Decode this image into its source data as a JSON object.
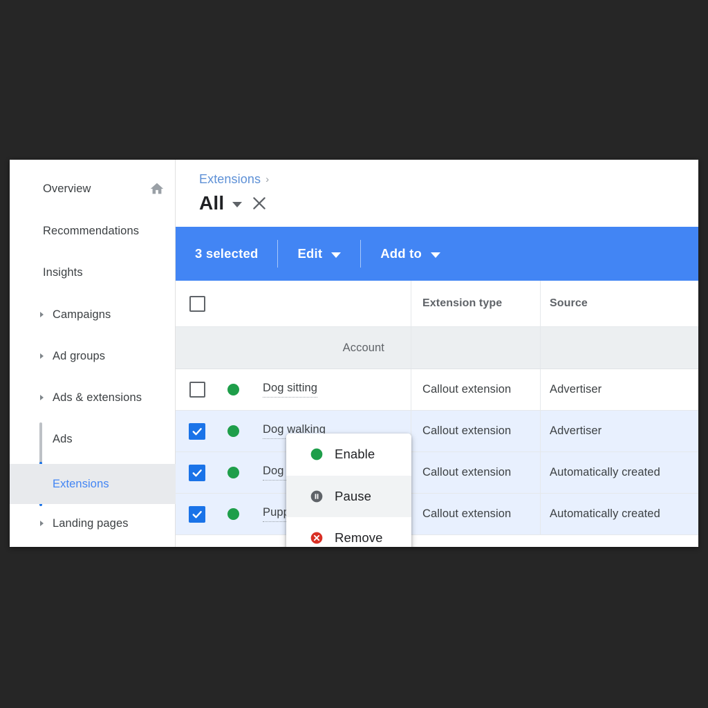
{
  "app": {
    "accent_blue": "#4285f4",
    "link_blue": "#5d90d6",
    "status_green": "#1e9e4a",
    "remove_red": "#d93025",
    "pause_gray": "#5f6368",
    "background": "#262626"
  },
  "sidebar": {
    "items": [
      {
        "label": "Overview",
        "icon": "home-icon",
        "expandable": false,
        "active": false
      },
      {
        "label": "Recommendations",
        "icon": "",
        "expandable": false,
        "active": false
      },
      {
        "label": "Insights",
        "icon": "",
        "expandable": false,
        "active": false
      },
      {
        "label": "Campaigns",
        "icon": "chevron-right-icon",
        "expandable": true,
        "active": false
      },
      {
        "label": "Ad groups",
        "icon": "chevron-right-icon",
        "expandable": true,
        "active": false
      },
      {
        "label": "Ads & extensions",
        "icon": "chevron-right-icon",
        "expandable": true,
        "active": false
      },
      {
        "label": "Ads",
        "icon": "",
        "expandable": false,
        "active": false
      },
      {
        "label": "Extensions",
        "icon": "",
        "expandable": false,
        "active": true
      },
      {
        "label": "Landing pages",
        "icon": "chevron-right-icon",
        "expandable": true,
        "active": false
      }
    ]
  },
  "header": {
    "breadcrumb": "Extensions",
    "breadcrumb_separator": "›",
    "title": "All",
    "dropdown_icon": "chevron-down-icon",
    "close_icon": "close-icon"
  },
  "action_bar": {
    "selection_count": "3 selected",
    "edit_label": "Edit",
    "add_to_label": "Add to",
    "edit_caret": "chevron-down-icon",
    "add_to_caret": "chevron-down-icon"
  },
  "edit_menu": {
    "items": [
      {
        "label": "Enable",
        "icon": "enable-circle-icon",
        "color": "#1e9e4a",
        "hovered": false
      },
      {
        "label": "Pause",
        "icon": "pause-circle-icon",
        "color": "#5f6368",
        "hovered": true
      },
      {
        "label": "Remove",
        "icon": "remove-circle-icon",
        "color": "#d93025",
        "hovered": false
      }
    ]
  },
  "table": {
    "columns": [
      "",
      "",
      "",
      "Extension type",
      "Source"
    ],
    "header": {
      "select_all_checkbox": "unchecked",
      "extension_type": "Extension type",
      "source": "Source"
    },
    "summary_row": {
      "label": "Account"
    },
    "rows": [
      {
        "checked": false,
        "status": "enabled",
        "name": "Dog sitting",
        "type": "Callout extension",
        "source": "Advertiser"
      },
      {
        "checked": true,
        "status": "enabled",
        "name": "Dog walking",
        "type": "Callout extension",
        "source": "Advertiser"
      },
      {
        "checked": true,
        "status": "enabled",
        "name": "Dog training",
        "type": "Callout extension",
        "source": "Automatically created"
      },
      {
        "checked": true,
        "status": "enabled",
        "name": "Puppy school",
        "type": "Callout extension",
        "source": "Automatically created"
      }
    ]
  }
}
